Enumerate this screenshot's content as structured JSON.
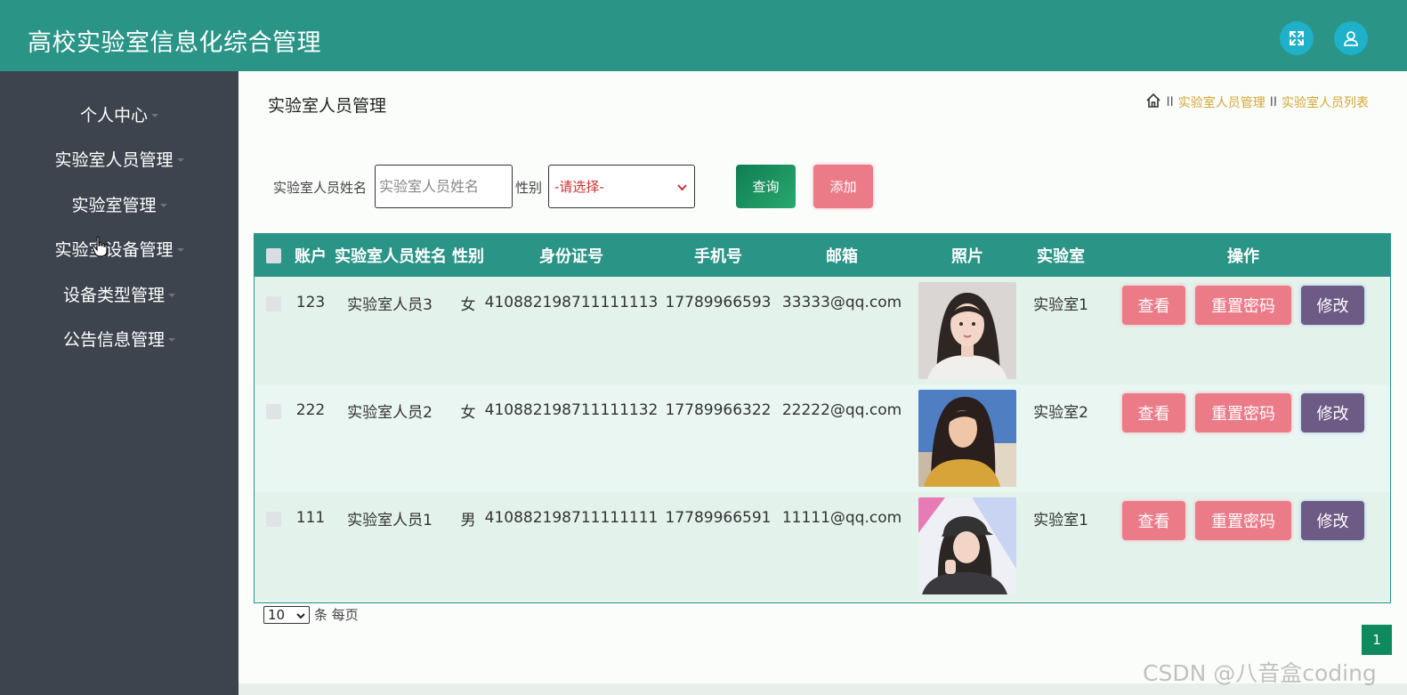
{
  "header": {
    "app_title": "高校实验室信息化综合管理",
    "icons": [
      "expand-icon",
      "user-icon"
    ]
  },
  "sidebar": {
    "items": [
      {
        "label": "个人中心"
      },
      {
        "label": "实验室人员管理"
      },
      {
        "label": "实验室管理"
      },
      {
        "label": "实验室设备管理"
      },
      {
        "label": "设备类型管理"
      },
      {
        "label": "公告信息管理"
      }
    ]
  },
  "main": {
    "page_title": "实验室人员管理",
    "breadcrumb": {
      "icon": "home-icon",
      "separator": "II",
      "items": [
        "实验室人员管理",
        "实验室人员列表"
      ]
    },
    "search": {
      "name_label": "实验室人员姓名",
      "name_placeholder": "实验室人员姓名",
      "gender_label": "性别",
      "gender_selected": "-请选择-",
      "query_label": "查询",
      "add_label": "添加"
    },
    "table": {
      "headers": [
        "账户",
        "实验室人员姓名",
        "性别",
        "身份证号",
        "手机号",
        "邮箱",
        "照片",
        "实验室",
        "操作"
      ],
      "rows": [
        {
          "account": "123",
          "name": "实验室人员3",
          "gender": "女",
          "id_number": "410882198711111113",
          "phone": "17789966593",
          "email": "33333@qq.com",
          "lab": "实验室1"
        },
        {
          "account": "222",
          "name": "实验室人员2",
          "gender": "女",
          "id_number": "410882198711111132",
          "phone": "17789966322",
          "email": "22222@qq.com",
          "lab": "实验室2"
        },
        {
          "account": "111",
          "name": "实验室人员1",
          "gender": "男",
          "id_number": "410882198711111111",
          "phone": "17789966591",
          "email": "11111@qq.com",
          "lab": "实验室1"
        }
      ],
      "actions": {
        "view": "查看",
        "reset": "重置密码",
        "edit": "修改"
      }
    },
    "pagination": {
      "page_size": "10",
      "per_page_text": "条 每页",
      "current_page": "1"
    }
  },
  "watermark": "CSDN @八音盒coding",
  "colors": {
    "header": "#2a9486",
    "sidebar": "#3d444d",
    "pink_button": "#ec7b88",
    "purple_button": "#6e5b85",
    "query_button": "#1a935f",
    "breadcrumb": "#d6a531"
  }
}
